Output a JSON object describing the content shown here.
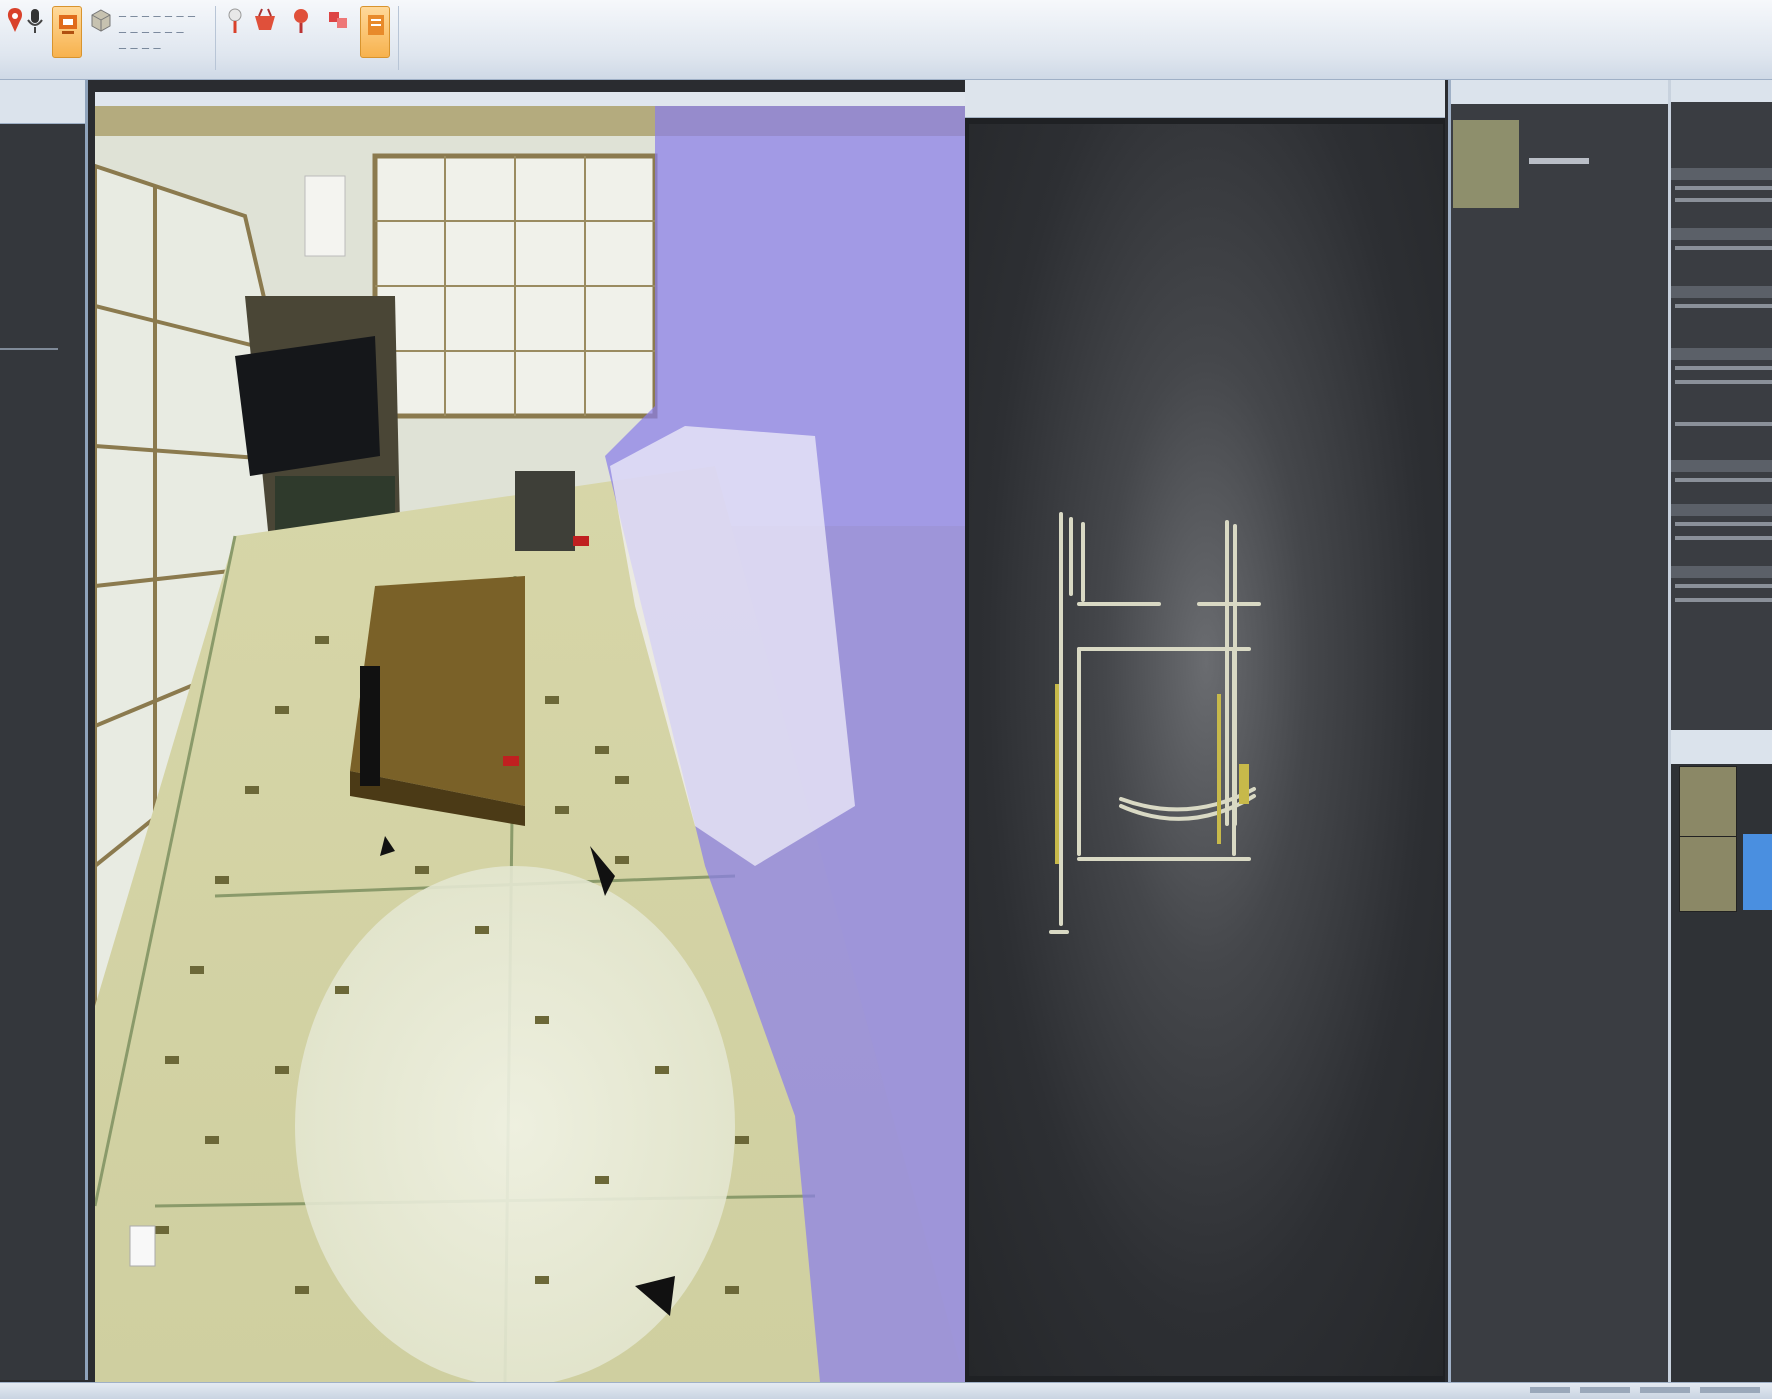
{
  "theme": {
    "ribbon_bg": "#dfe6ef",
    "panel_dark": "#34373c",
    "selection_blue": "#4a8fe0",
    "wall_overlay": "#8a7eea",
    "ribbon_active": "#f7b24e"
  },
  "ribbon": {
    "tools": [
      {
        "icon": "red-pin-icon"
      },
      {
        "icon": "microphone-icon"
      },
      {
        "icon": "scan-icon"
      },
      {
        "icon": "cube-icon"
      },
      {
        "icon": "red-marker-icon"
      },
      {
        "icon": "basket-icon"
      },
      {
        "icon": "red-marker-icon"
      },
      {
        "icon": "cube-stack-icon"
      },
      {
        "icon": "export-icon"
      }
    ]
  },
  "views": {
    "photo_view": {
      "content": "3D room view with purple wall overlay"
    },
    "cloud_view": {
      "content": "top-down point cloud floor plan"
    }
  },
  "thumbnails": {
    "count": 1
  },
  "properties": {
    "categories": 8
  },
  "layers": {
    "items": 2,
    "selected_index": 1
  }
}
